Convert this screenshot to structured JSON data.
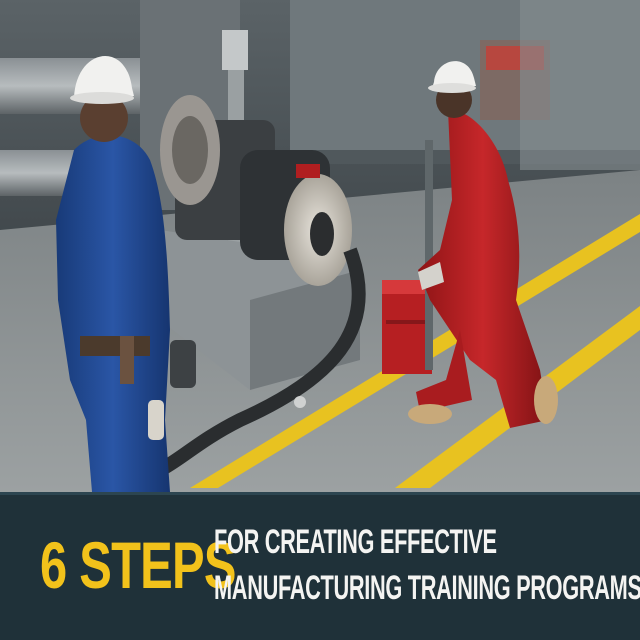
{
  "banner": {
    "highlight": "6 STEPS",
    "line1": "FOR CREATING EFFECTIVE",
    "line2": "MANUFACTURING TRAINING PROGRAMS"
  },
  "colors": {
    "banner_background": "#1f3139",
    "highlight": "#f2c21b",
    "text": "#f4f4f2",
    "floor_stripe": "#e8c220",
    "floor": "#8d9294",
    "worker_left_coverall": "#22478f",
    "worker_right_coverall": "#b51f22",
    "helmet": "#f1f1ef"
  },
  "scene": {
    "elements": [
      "industrial-motor",
      "pipe",
      "worker-blue",
      "worker-red",
      "toolbox",
      "floor-stripes"
    ]
  }
}
